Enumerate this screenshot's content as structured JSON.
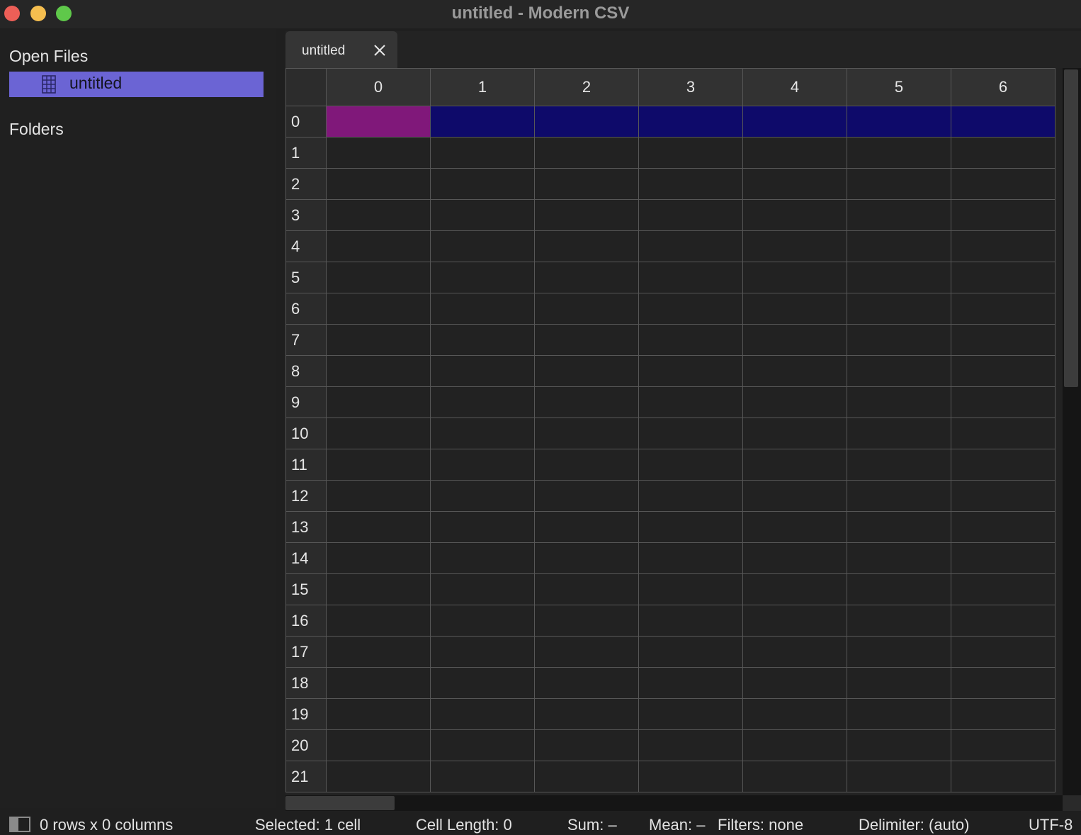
{
  "window": {
    "title": "untitled - Modern CSV"
  },
  "sidebar": {
    "open_files_heading": "Open Files",
    "open_files": [
      {
        "label": "untitled",
        "icon": "spreadsheet-icon",
        "selected": true
      }
    ],
    "folders_heading": "Folders"
  },
  "tabs": [
    {
      "label": "untitled",
      "close_icon": "close-icon"
    }
  ],
  "grid": {
    "column_headers": [
      "0",
      "1",
      "2",
      "3",
      "4",
      "5",
      "6"
    ],
    "row_headers": [
      "0",
      "1",
      "2",
      "3",
      "4",
      "5",
      "6",
      "7",
      "8",
      "9",
      "10",
      "11",
      "12",
      "13",
      "14",
      "15",
      "16",
      "17",
      "18",
      "19",
      "20",
      "21"
    ],
    "current_cell": {
      "row": 0,
      "col": 0
    },
    "selected_row": 0,
    "colors": {
      "current_cell": "#80187a",
      "selected_row": "#0e0a6a"
    }
  },
  "status": {
    "dimensions": "0 rows x 0 columns",
    "selected": "Selected: 1 cell",
    "cell_length": "Cell Length: 0",
    "sum": "Sum: –",
    "mean": "Mean: –",
    "filters": "Filters: none",
    "delimiter": "Delimiter: (auto)",
    "encoding": "UTF-8"
  },
  "colors": {
    "accent_sidebar_selection": "#6b64d4",
    "close_button": "#ed5f57",
    "minimize_button": "#f5be4f",
    "maximize_button": "#5fc84a"
  }
}
